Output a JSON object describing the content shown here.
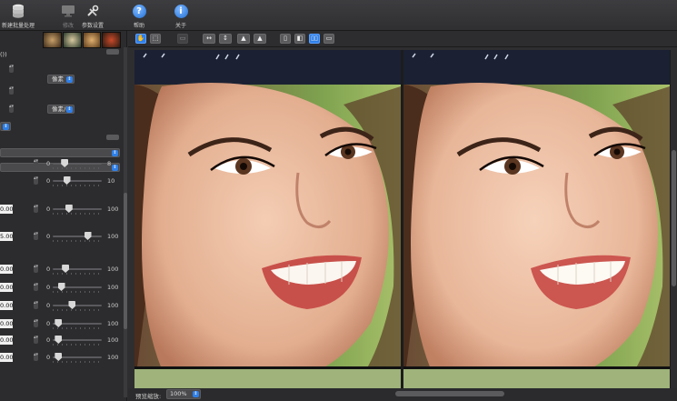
{
  "toolbar": {
    "items": [
      {
        "label": "新建批量处理",
        "icon": "database-stack-icon"
      },
      {
        "label": "修改",
        "icon": "monitor-icon"
      },
      {
        "label": "参数设置",
        "icon": "wrench-icon"
      },
      {
        "label": "帮助",
        "icon": "help-icon",
        "glyph": "?"
      },
      {
        "label": "关于",
        "icon": "info-icon",
        "glyph": "i"
      }
    ]
  },
  "left_panel": {
    "label_top": "())",
    "dropdown1": "像素",
    "dropdown2": "像素/in",
    "sliders": [
      {
        "value": "",
        "min": "0",
        "max": "8",
        "level": 0.2
      },
      {
        "value": "",
        "min": "0",
        "max": "10",
        "level": 0.25
      },
      {
        "value": "0.00",
        "min": "0",
        "max": "100",
        "level": 0.3
      },
      {
        "value": "5.00",
        "min": "0",
        "max": "100",
        "level": 0.75
      },
      {
        "value": "0.00",
        "min": "0",
        "max": "100",
        "level": 0.22
      },
      {
        "value": "0.00",
        "min": "0",
        "max": "100",
        "level": 0.12
      },
      {
        "value": "0.00",
        "min": "0",
        "max": "100",
        "level": 0.38
      },
      {
        "value": "0.00",
        "min": "0",
        "max": "100",
        "level": 0.05
      },
      {
        "value": "0.00",
        "min": "0",
        "max": "100",
        "level": 0.05
      },
      {
        "value": "0.00",
        "min": "0",
        "max": "100",
        "level": 0.05
      }
    ]
  },
  "view_toolbar": {
    "buttons": [
      "hand-icon",
      "select-icon",
      "crop-icon",
      "fit-width-icon",
      "fit-height-icon",
      "image-icon",
      "image-alt-icon",
      "single-view-icon",
      "split-view-icon",
      "side-by-side-icon",
      "stacked-view-icon"
    ]
  },
  "status": {
    "label": "预览缩放:",
    "zoom": "100%"
  },
  "colors": {
    "accent": "#2f7fe8",
    "background": "#2e2e30"
  }
}
